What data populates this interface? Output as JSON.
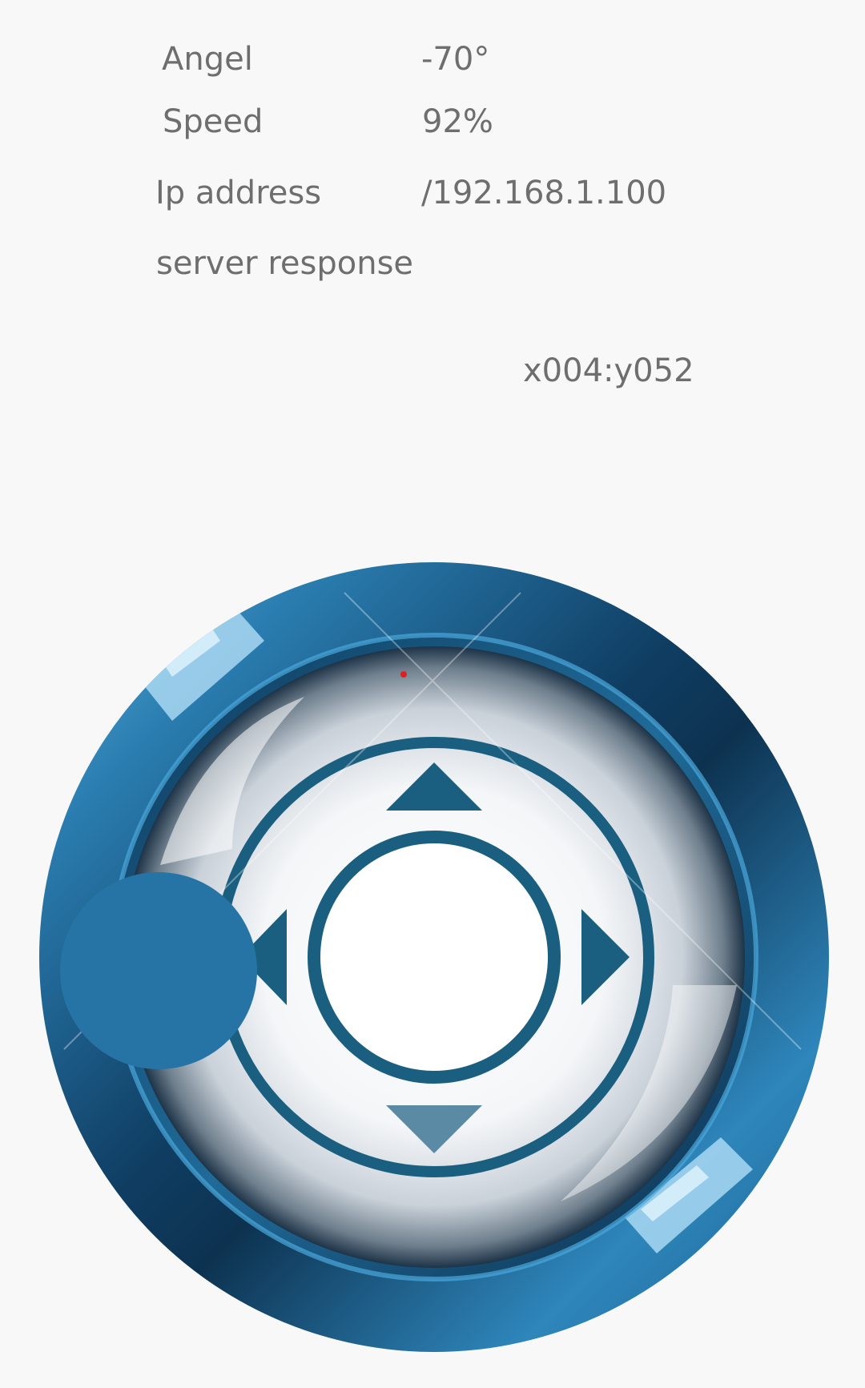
{
  "status": {
    "angle_label": "Angel",
    "angle_value": "-70°",
    "speed_label": "Speed",
    "speed_value": "92%",
    "ip_label": "Ip address",
    "ip_value": "/192.168.1.100",
    "server_label": "server response",
    "server_value": "",
    "coordinates": "x004:y052"
  },
  "joystick": {
    "colors": {
      "ring_dark": "#0d3250",
      "ring_mid": "#2370a0",
      "ring_light": "#5fb3e0",
      "arrow": "#1a5f80",
      "knob": "#2674a6",
      "indicator": "#e02020"
    }
  }
}
